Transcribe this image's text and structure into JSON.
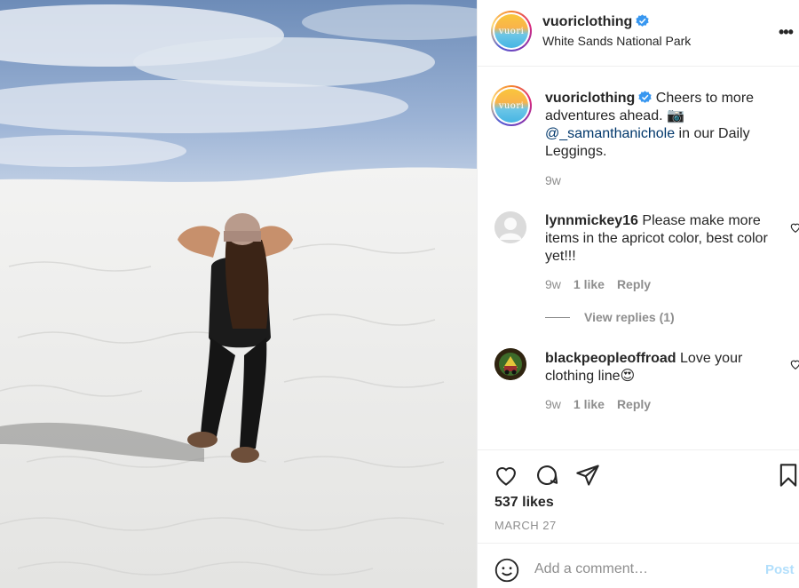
{
  "post": {
    "username": "vuoriclothing",
    "location": "White Sands National Park",
    "avatar_text": "vuori",
    "verified": true
  },
  "caption": {
    "username": "vuoriclothing",
    "text_1": "Cheers to more adventures ahead. 📷",
    "mention": "@_samanthanichole",
    "text_2": " in our Daily Leggings.",
    "age": "9w"
  },
  "comments": [
    {
      "username": "lynnmickey16",
      "text": "Please make more items in the apricot color, best color yet!!!",
      "age": "9w",
      "likes": "1 like",
      "reply": "Reply",
      "view_replies": "View replies (1)"
    },
    {
      "username": "blackpeopleoffroad",
      "text": "Love your clothing line😍",
      "age": "9w",
      "likes": "1 like",
      "reply": "Reply"
    }
  ],
  "actions": {
    "likes": "537 likes",
    "date": "MARCH 27",
    "icons": [
      "heart-icon",
      "comment-icon",
      "share-icon",
      "bookmark-icon"
    ]
  },
  "add_comment": {
    "placeholder": "Add a comment…",
    "post_label": "Post"
  },
  "colors": {
    "text": "#262626",
    "muted": "#8e8e8e",
    "verified": "#3897f0",
    "mention": "#00376b",
    "post_disabled": "#b2dffc"
  }
}
